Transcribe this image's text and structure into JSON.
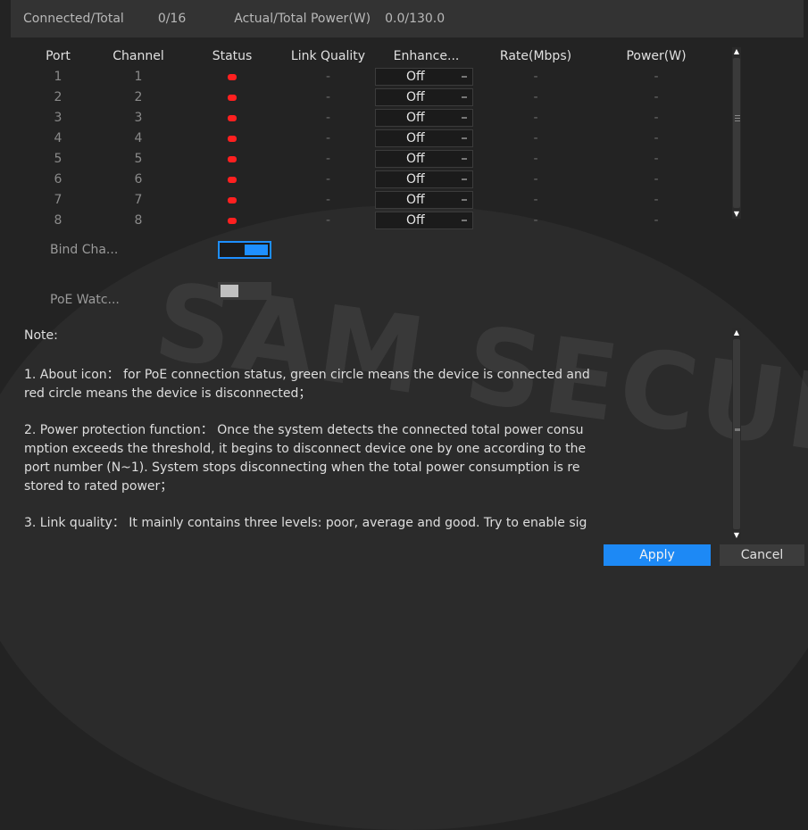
{
  "summary": {
    "connected_label": "Connected/Total",
    "connected_value": "0/16",
    "power_label": "Actual/Total Power(W)",
    "power_value": "0.0/130.0"
  },
  "table": {
    "columns": [
      "Port",
      "Channel",
      "Status",
      "Link Quality",
      "Enhance...",
      "Rate(Mbps)",
      "Power(W)"
    ],
    "rows": [
      {
        "port": "1",
        "channel": "1",
        "status": "disconnected",
        "link_quality": "-",
        "enhance": "Off",
        "rate": "-",
        "power": "-"
      },
      {
        "port": "2",
        "channel": "2",
        "status": "disconnected",
        "link_quality": "-",
        "enhance": "Off",
        "rate": "-",
        "power": "-"
      },
      {
        "port": "3",
        "channel": "3",
        "status": "disconnected",
        "link_quality": "-",
        "enhance": "Off",
        "rate": "-",
        "power": "-"
      },
      {
        "port": "4",
        "channel": "4",
        "status": "disconnected",
        "link_quality": "-",
        "enhance": "Off",
        "rate": "-",
        "power": "-"
      },
      {
        "port": "5",
        "channel": "5",
        "status": "disconnected",
        "link_quality": "-",
        "enhance": "Off",
        "rate": "-",
        "power": "-"
      },
      {
        "port": "6",
        "channel": "6",
        "status": "disconnected",
        "link_quality": "-",
        "enhance": "Off",
        "rate": "-",
        "power": "-"
      },
      {
        "port": "7",
        "channel": "7",
        "status": "disconnected",
        "link_quality": "-",
        "enhance": "Off",
        "rate": "-",
        "power": "-"
      },
      {
        "port": "8",
        "channel": "8",
        "status": "disconnected",
        "link_quality": "-",
        "enhance": "Off",
        "rate": "-",
        "power": "-"
      }
    ]
  },
  "options": {
    "bind_channel_label": "Bind Cha...",
    "bind_channel_on": true,
    "poe_watchdog_label": "PoE Watc...",
    "poe_watchdog_on": false
  },
  "note": {
    "title": "Note:",
    "p1_line1": "1. About icon： for PoE connection status, green circle means the device is connected and",
    "p1_line2": " red circle means the device is disconnected；",
    "p2_line1": "2. Power protection function： Once the system detects the connected total power consu",
    "p2_line2": "mption exceeds the threshold, it begins to disconnect device one by one according to the",
    "p2_line3": " port number (N~1). System stops disconnecting when the total power consumption is re",
    "p2_line4": "stored to rated power；",
    "p3_line1": "3. Link quality： It mainly contains three levels: poor, average and good. Try to enable sig"
  },
  "buttons": {
    "apply": "Apply",
    "cancel": "Cancel"
  },
  "watermark": "SAM SECURITY",
  "colors": {
    "background": "#232323",
    "status_disconnected": "#ff2020",
    "accent": "#1e8fff"
  }
}
